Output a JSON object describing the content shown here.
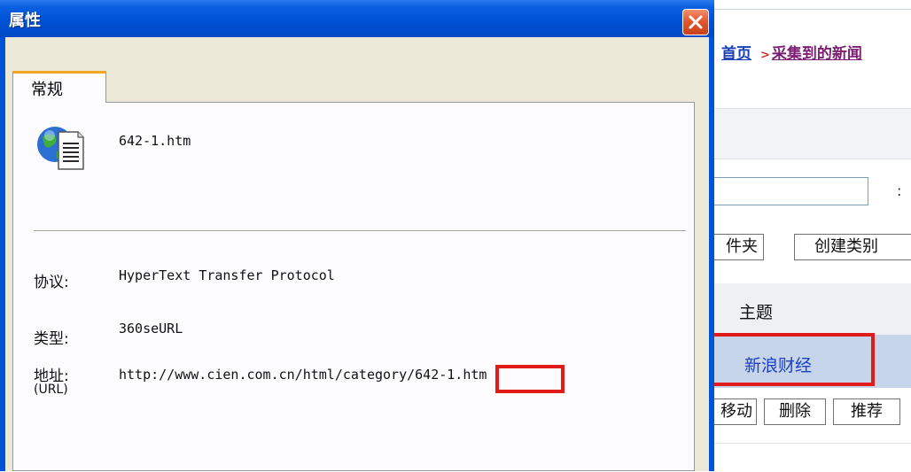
{
  "dialog": {
    "title": "属性",
    "tab_general": "常规",
    "file_name": "642-1.htm",
    "props": {
      "protocol_label": "协议:",
      "protocol_value": "HyperText Transfer Protocol",
      "type_label": "类型:",
      "type_value": "360seURL",
      "address_label": "地址:",
      "address_sublabel": "(URL)",
      "address_value": "http://www.cien.com.cn/html/category/642-1.htm"
    },
    "icons": {
      "close": "close-icon",
      "file": "web-document-icon"
    }
  },
  "background_page": {
    "breadcrumb_home": "首页",
    "breadcrumb_sep": ">",
    "breadcrumb_current": "采集到的新闻",
    "btn_folder": "件夹",
    "btn_create_category": "创建类别",
    "column_subject": "主题",
    "selected_row_text": "新浪财经",
    "btn_move": "移动",
    "btn_delete": "删除",
    "btn_recommend": "推荐",
    "stray_colon": ":"
  },
  "colors": {
    "titlebar_blue": "#0052d6",
    "highlight_red": "#e11a1a",
    "selected_row": "#c6d5ea",
    "tab_accent": "#f5a623"
  }
}
